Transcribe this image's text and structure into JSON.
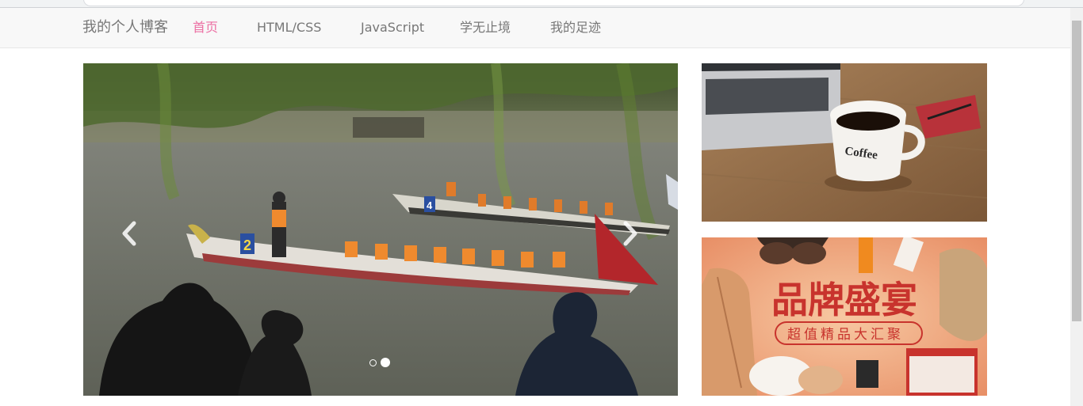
{
  "navbar": {
    "brand": "我的个人博客",
    "items": [
      {
        "label": "首页",
        "active": true
      },
      {
        "label": "HTML/CSS",
        "active": false
      },
      {
        "label": "JavaScript",
        "active": false
      },
      {
        "label": "学无止境",
        "active": false
      },
      {
        "label": "我的足迹",
        "active": false
      }
    ]
  },
  "carousel": {
    "slide_count": 2,
    "active_index": 1,
    "boat_numbers": [
      "2",
      "4"
    ],
    "prev_icon": "chevron-left-icon",
    "next_icon": "chevron-right-icon"
  },
  "side_banners": {
    "coffee": {
      "cup_text": "Coffee"
    },
    "promo": {
      "title": "品牌盛宴",
      "subtitle": "超值精品大汇聚"
    }
  },
  "colors": {
    "accent_pink": "#ec6fa3",
    "nav_text": "#777777",
    "navbar_bg": "#f8f8f8"
  }
}
